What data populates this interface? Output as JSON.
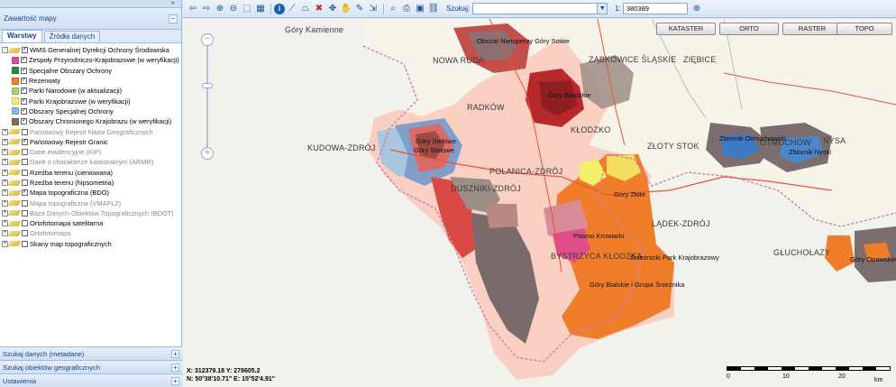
{
  "left_panel": {
    "collapse_icon": "double-chevron-left",
    "contents_title": "Zawartość mapy",
    "tabs": [
      {
        "label": "Warstwy",
        "active": true
      },
      {
        "label": "Źródła danych",
        "active": false
      }
    ],
    "tree": [
      {
        "label": "WMS Generalnej Dyrekcji Ochrony Środowiska",
        "level": 0,
        "toggle": "-",
        "checked": true,
        "icon": "layer-group-icon",
        "dim": false
      },
      {
        "label": "Zespoły Przyrodniczo-Krajobrazowe (w weryfikacji)",
        "level": 1,
        "checked": true,
        "swatch": "#e24aa0",
        "dim": false
      },
      {
        "label": "Specjalne Obszary Ochrony",
        "level": 1,
        "checked": true,
        "swatch": "#2e8b3a",
        "dim": false
      },
      {
        "label": "Rezerwaty",
        "level": 1,
        "checked": true,
        "swatch": "#f07d2a",
        "dim": false
      },
      {
        "label": "Parki Narodowe (w aktualizacji)",
        "level": 1,
        "checked": true,
        "swatch": "#a6d56b",
        "dim": false
      },
      {
        "label": "Parki Krajobrazowe (w weryfikacji)",
        "level": 1,
        "checked": true,
        "swatch": "#f3ef6a",
        "dim": false
      },
      {
        "label": "Obszary Specjalnej Ochrony",
        "level": 1,
        "checked": true,
        "swatch": "#8db8d8",
        "dim": false
      },
      {
        "label": "Obszary Chronionego Krajobrazu (w weryfikacji)",
        "level": 1,
        "checked": true,
        "swatch": "#8a6b57",
        "dim": false
      },
      {
        "label": "Państwowy Rejestr Nazw Geograficznych",
        "level": 0,
        "toggle": "+",
        "checked": false,
        "icon": "layer-group-icon",
        "dim": true
      },
      {
        "label": "Państwowy Rejestr Granic",
        "level": 0,
        "toggle": "+",
        "checked": true,
        "icon": "layer-group-icon",
        "dim": false
      },
      {
        "label": "Dane ewidencyjne (KIP)",
        "level": 0,
        "toggle": "+",
        "checked": false,
        "icon": "layer-group-icon",
        "dim": true
      },
      {
        "label": "Dane o charakterze katastralnym (ARMR)",
        "level": 0,
        "toggle": "+",
        "checked": false,
        "icon": "layer-group-icon",
        "dim": true
      },
      {
        "label": "Rzeźba terenu (cieniowana)",
        "level": 0,
        "toggle": "+",
        "checked": false,
        "icon": "layer-group-icon",
        "dim": false
      },
      {
        "label": "Rzeźba terenu (hipsometria)",
        "level": 0,
        "toggle": "+",
        "checked": false,
        "icon": "layer-group-icon",
        "dim": false
      },
      {
        "label": "Mapa topograficzna (BDO)",
        "level": 0,
        "toggle": "+",
        "checked": true,
        "icon": "layer-group-icon",
        "dim": false
      },
      {
        "label": "Mapa topograficzna (VMAPL2)",
        "level": 0,
        "toggle": "+",
        "checked": false,
        "icon": "layer-group-icon",
        "dim": true
      },
      {
        "label": "Baza Danych Obiektów Topograficznych (BDOT)",
        "level": 0,
        "toggle": "+",
        "checked": false,
        "icon": "layer-group-icon",
        "dim": true
      },
      {
        "label": "Ortofotomapa satelitarna",
        "level": 0,
        "toggle": "+",
        "checked": false,
        "icon": "layer-group-icon",
        "dim": false
      },
      {
        "label": "Ortofotomapa",
        "level": 0,
        "toggle": "+",
        "checked": false,
        "icon": "layer-group-icon",
        "dim": true
      },
      {
        "label": "Skany map topograficznych",
        "level": 0,
        "toggle": "+",
        "checked": false,
        "icon": "layer-group-icon",
        "dim": false
      }
    ],
    "accordions": [
      {
        "label": "Szukaj danych (metadane)"
      },
      {
        "label": "Szukaj obiektów geograficznych"
      },
      {
        "label": "Ustawienia"
      }
    ]
  },
  "toolbar": {
    "icons": [
      "arrow-left-icon",
      "arrow-right-icon",
      "zoom-in-icon",
      "zoom-out-icon",
      "zoom-box-icon",
      "full-extent-icon",
      "info-icon",
      "measure-line-icon",
      "measure-area-icon",
      "clear-icon",
      "pan-icon",
      "hand-icon",
      "draw-icon",
      "export-icon",
      "search-map-icon",
      "print-icon",
      "save-icon",
      "link-icon"
    ],
    "search_label": "Szukaj:",
    "search_value": "",
    "scale_label": "1:",
    "scale_value": "380389",
    "scale_go_icon": "zoom-to-scale-icon"
  },
  "map": {
    "base_buttons": [
      "KATASTER",
      "ORTO",
      "RASTER",
      "TOPO"
    ],
    "towns": [
      "Góry Kamienne",
      "NOWA RUDA",
      "ZĄBKOWICE ŚLĄSKIE",
      "ZIĘBICE",
      "KUDOWA-ZDRÓJ",
      "RADKÓW",
      "POLANICA-ZDRÓJ",
      "KŁODZKO",
      "DUSZNIKI-ZDRÓJ",
      "LĄDEK-ZDRÓJ",
      "ZŁOTY STOK",
      "OTMUCHÓW",
      "NYSA",
      "GŁUCHOŁAZY",
      "BYSTRZYCA KŁODZKA"
    ],
    "areas": [
      "Obszar Nietoperzy Góry Sowie",
      "Góry Bardzkie",
      "Góry Stołowe",
      "Góry Stołowe",
      "Zbiornik Otmuchowski",
      "Zbiornik Nyski",
      "Góry Złote",
      "Pasmo Krowiarki",
      "Śnieżnicki Park Krajobrazowy",
      "Góry Bialskie i Grupa Śnieżnika",
      "Góry Opawskie"
    ],
    "coords_xy": "X: 312379.18   Y: 278605.2",
    "coords_ne": "N: 50°38'10.71\" E: 15°52'4.91\"",
    "scalebar_labels": [
      "0",
      "10",
      "20",
      "km"
    ]
  },
  "colors": {
    "accent": "#15428b",
    "panel_border": "#99bbe8",
    "orange": "#f07d2a",
    "grey_brown": "#7c6e6e",
    "red_reserve": "#c23b3b",
    "pink_zone": "#f5c0b5"
  }
}
